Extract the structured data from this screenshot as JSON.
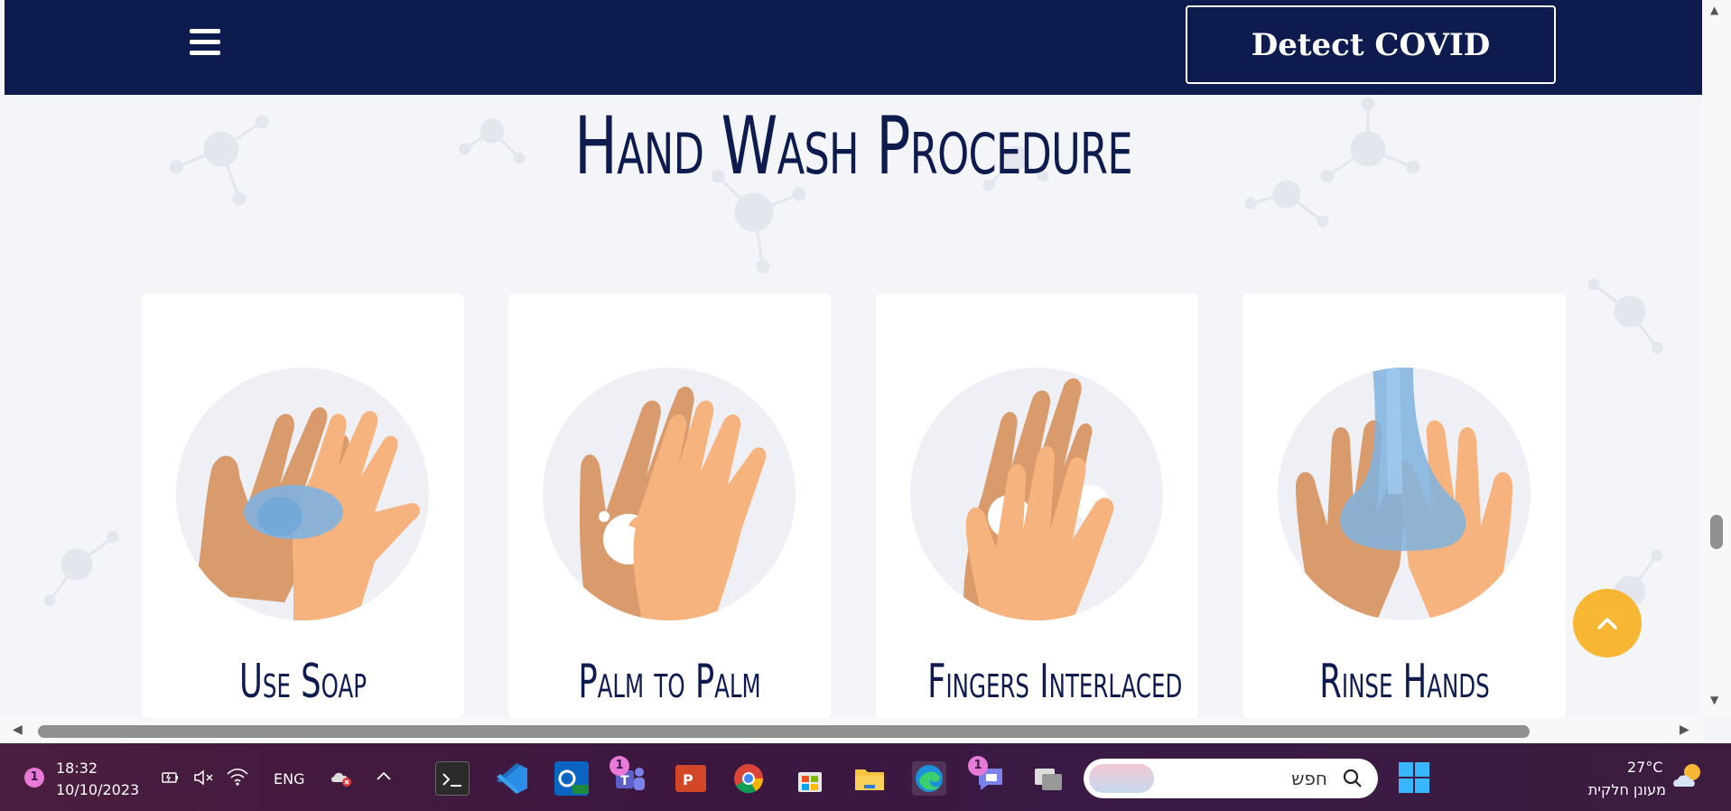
{
  "header": {
    "cta_label": "Detect COVID"
  },
  "section": {
    "title": "Hand Wash Procedure"
  },
  "cards": [
    {
      "label": "Use Soap"
    },
    {
      "label": "Palm to Palm"
    },
    {
      "label": "Fingers Interlaced"
    },
    {
      "label": "Rinse Hands"
    }
  ],
  "colors": {
    "navy": "#0d1b4f",
    "accent": "#f7b733",
    "skin_dark": "#d99a6c",
    "skin_light": "#f7b37d",
    "soap": "#7fb3e0"
  },
  "taskbar": {
    "time": "18:32",
    "date": "10/10/2023",
    "notification_count": "1",
    "language": "ENG",
    "teams_badge": "1",
    "chat_badge": "1",
    "search_placeholder": "חפש",
    "temperature": "27°C",
    "weather_text": "מעונן חלקית"
  }
}
